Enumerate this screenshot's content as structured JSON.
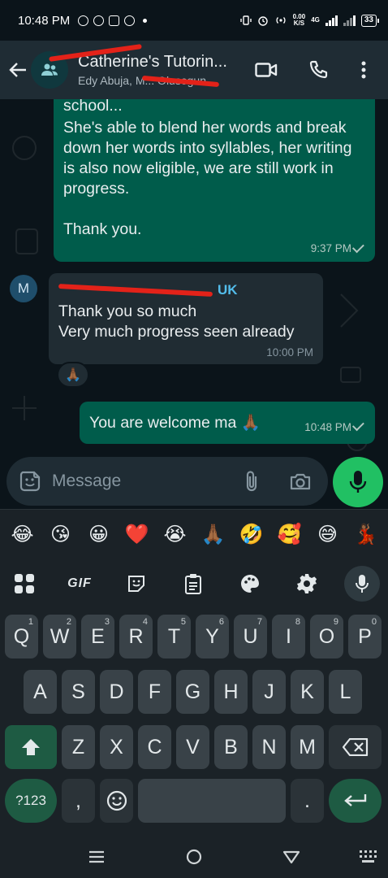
{
  "status_bar": {
    "time": "10:48 PM",
    "speed_top": "0.00",
    "speed_bottom": "K/S",
    "network": "4G",
    "battery": "33"
  },
  "header": {
    "title": "Catherine's Tutorin...",
    "subtitle": "Edy Abuja, M... Olusegun..."
  },
  "messages": [
    {
      "direction": "outgoing",
      "text_partial_top": "school...",
      "text": "She's able to blend her words and break down her words into syllables, her writing is also now eligible, we are still work in progress.\n\nThank you.",
      "time": "9:37 PM"
    },
    {
      "direction": "incoming",
      "sender_initial": "M",
      "sender_suffix": "UK",
      "text": "Thank you so much\nVery much progress seen already",
      "time": "10:00 PM",
      "reaction": "🙏🏾"
    },
    {
      "direction": "outgoing",
      "text": "You are welcome ma 🙏🏾",
      "time": "10:48 PM"
    }
  ],
  "composer": {
    "placeholder": "Message"
  },
  "emoji_row": [
    "😂",
    "😘",
    "😀",
    "❤️",
    "😭",
    "🙏🏾",
    "🤣",
    "🥰",
    "😅",
    "💃🏾"
  ],
  "toolbar": {
    "gif_label": "GIF"
  },
  "keyboard": {
    "row1": [
      {
        "key": "Q",
        "hint": "1"
      },
      {
        "key": "W",
        "hint": "2"
      },
      {
        "key": "E",
        "hint": "3"
      },
      {
        "key": "R",
        "hint": "4"
      },
      {
        "key": "T",
        "hint": "5"
      },
      {
        "key": "Y",
        "hint": "6"
      },
      {
        "key": "U",
        "hint": "7"
      },
      {
        "key": "I",
        "hint": "8"
      },
      {
        "key": "O",
        "hint": "9"
      },
      {
        "key": "P",
        "hint": "0"
      }
    ],
    "row2": [
      "A",
      "S",
      "D",
      "F",
      "G",
      "H",
      "J",
      "K",
      "L"
    ],
    "row3": [
      "Z",
      "X",
      "C",
      "V",
      "B",
      "N",
      "M"
    ],
    "sym_label": "?123",
    "comma": ",",
    "period": "."
  },
  "colors": {
    "accent_green": "#21c063",
    "outgoing_bubble": "#005c4b",
    "incoming_bubble": "#202c33",
    "sender_name": "#53bdeb",
    "redaction": "#e32219"
  }
}
